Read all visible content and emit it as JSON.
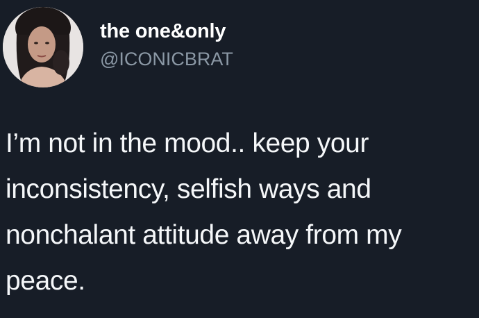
{
  "tweet": {
    "author": {
      "display_name": "the one&only",
      "handle": "@ICONICBRAT"
    },
    "text": "I’m not in the mood.. keep your\ninconsistency, selfish ways and\nnonchalant attitude away from my\npeace."
  },
  "colors": {
    "background": "#171d27",
    "text": "#ffffff",
    "secondary_text": "#8b98a5"
  }
}
